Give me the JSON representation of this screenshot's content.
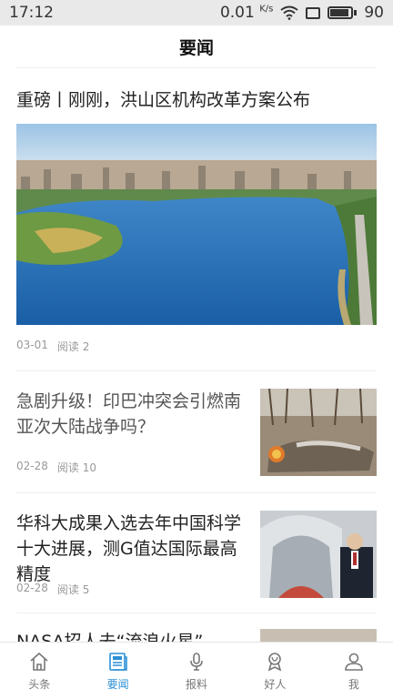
{
  "status_bar": {
    "time": "17:12",
    "speed_value": "0.01",
    "speed_unit": "K/s",
    "battery": "90"
  },
  "header": {
    "title": "要闻"
  },
  "articles": [
    {
      "title": "重磅丨刚刚，洪山区机构改革方案公布",
      "date": "03-01",
      "reads": "阅读 2"
    },
    {
      "title": "急剧升级！印巴冲突会引燃南亚次大陆战争吗？",
      "date": "02-28",
      "reads": "阅读 10"
    },
    {
      "title": "华科大成果入选去年中国科学十大进展，测G值达国际最高精度",
      "date": "02-28",
      "reads": "阅读 5"
    },
    {
      "title": "NASA招人去“流浪火星”"
    }
  ],
  "tabs": [
    {
      "label": "头条",
      "icon": "home-icon"
    },
    {
      "label": "要闻",
      "icon": "newspaper-icon",
      "active": true
    },
    {
      "label": "报料",
      "icon": "microphone-icon"
    },
    {
      "label": "好人",
      "icon": "award-icon"
    },
    {
      "label": "我",
      "icon": "person-icon"
    }
  ],
  "colors": {
    "accent": "#2a8fd6",
    "status_bar_bg": "#e9e9e9"
  }
}
